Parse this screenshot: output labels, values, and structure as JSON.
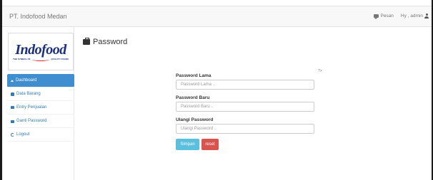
{
  "navbar": {
    "brand": "PT. Indofood Medan",
    "pesan_label": "Pesan",
    "user_label": "Hy , admin"
  },
  "sidebar": {
    "logo": {
      "word": "Indofood",
      "tag_left": "THE SYMBOL OF",
      "tag_right": "QUALITY FOODS"
    },
    "items": [
      {
        "label": "Dashboard",
        "icon": "home-icon",
        "active": true
      },
      {
        "label": "Data Barang",
        "icon": "database-icon"
      },
      {
        "label": "Entry Penjualan",
        "icon": "briefcase-icon"
      },
      {
        "label": "Ganti Password",
        "icon": "lock-icon"
      },
      {
        "label": "Logout",
        "icon": "logout-icon"
      }
    ]
  },
  "page": {
    "title": "Password",
    "title_icon": "briefcase-icon",
    "help": "?>"
  },
  "form": {
    "old_label": "Password Lama",
    "old_placeholder": "Password Lama ..",
    "new_label": "Password Baru",
    "new_placeholder": "Password Baru ..",
    "repeat_label": "Ulangi Password",
    "repeat_placeholder": "Ulangi Password ..",
    "save_label": "Simpan",
    "reset_label": "reset"
  },
  "colors": {
    "active_menu": "#3e8ed0",
    "link": "#337ab7",
    "save_button": "#5bc0de",
    "reset_button": "#d9534f",
    "logo_blue": "#1b2f7d",
    "logo_red": "#d8262e"
  }
}
